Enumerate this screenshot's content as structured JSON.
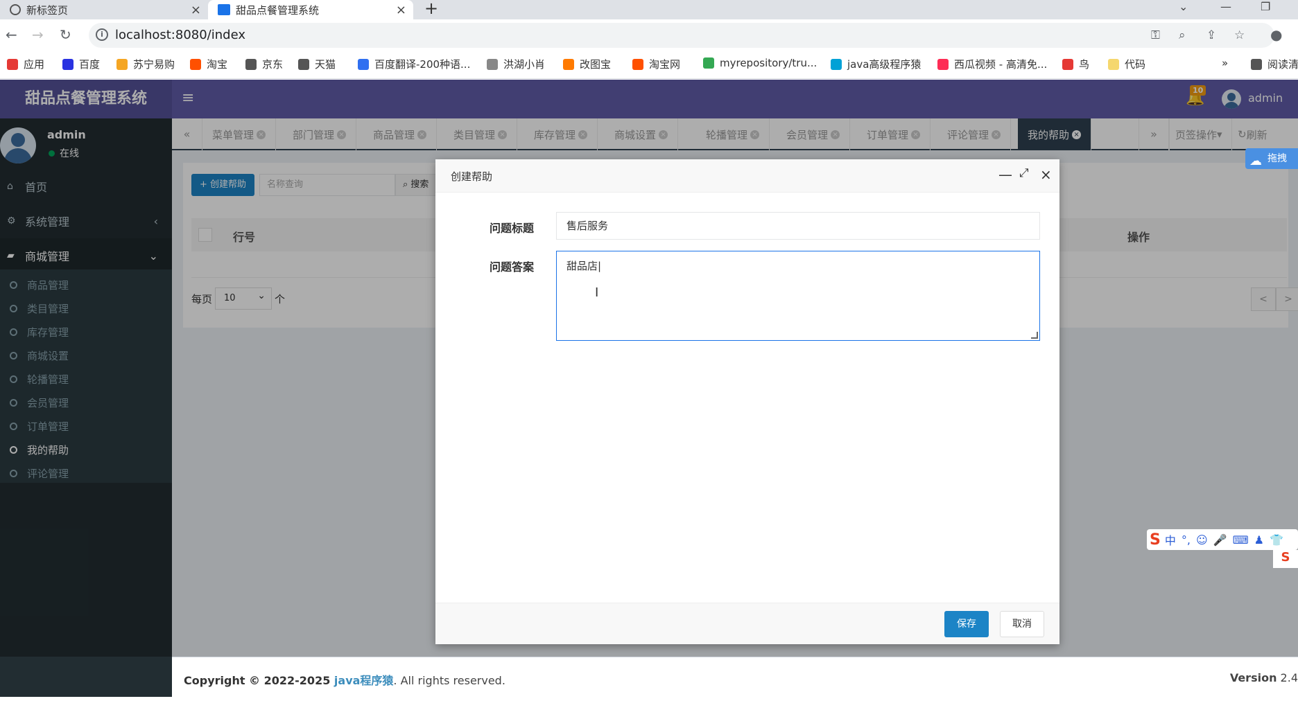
{
  "browser": {
    "tabs": [
      {
        "title": "新标签页"
      },
      {
        "title": "甜品点餐管理系统"
      }
    ],
    "new_tab": "+",
    "url": "localhost:8080/index",
    "bookmarks": [
      {
        "label": "应用",
        "color": "#e53935"
      },
      {
        "label": "百度",
        "color": "#2932e1"
      },
      {
        "label": "苏宁易购",
        "color": "#f5a623"
      },
      {
        "label": "淘宝",
        "color": "#ff5000"
      },
      {
        "label": "京东",
        "color": "#555555"
      },
      {
        "label": "天猫",
        "color": "#555555"
      },
      {
        "label": "百度翻译-200种语...",
        "color": "#2f6ff0"
      },
      {
        "label": "洪湖小肖",
        "color": "#888888"
      },
      {
        "label": "改图宝",
        "color": "#ff7a00"
      },
      {
        "label": "淘宝网",
        "color": "#ff5000"
      },
      {
        "label": "myrepository/tru...",
        "color": "#34a853"
      },
      {
        "label": "java高级程序猿",
        "color": "#00a1d6"
      },
      {
        "label": "西瓜视频 - 高清免...",
        "color": "#fe2c55"
      },
      {
        "label": "鸟",
        "color": "#e53935"
      },
      {
        "label": "代码",
        "color": "#f5d76e"
      },
      {
        "label": "阅读清",
        "color": "#555555"
      }
    ]
  },
  "app": {
    "logo": "甜品点餐管理系统",
    "hamburger_icon": "≡",
    "notification_count": "10",
    "username": "admin",
    "sidebar": {
      "user": "admin",
      "status": "在线",
      "menu": [
        {
          "label": "首页",
          "icon": "home-icon"
        },
        {
          "label": "系统管理",
          "icon": "gears-icon",
          "arrow": "‹"
        },
        {
          "label": "商城管理",
          "icon": "shopping-bag-icon",
          "arrow": "⌄"
        }
      ],
      "submenu": [
        "商品管理",
        "类目管理",
        "库存管理",
        "商城设置",
        "轮播管理",
        "会员管理",
        "订单管理",
        "我的帮助",
        "评论管理"
      ],
      "current_submenu": "我的帮助"
    },
    "page_tabs": [
      "菜单管理",
      "部门管理",
      "商品管理",
      "类目管理",
      "库存管理",
      "商城设置",
      "轮播管理",
      "会员管理",
      "订单管理",
      "评论管理",
      "我的帮助"
    ],
    "active_page_tab": "我的帮助",
    "tab_tools": {
      "page_ops": "页签操作",
      "refresh": "刷新"
    },
    "toolbar": {
      "create": "创建帮助",
      "search_placeholder": "名称查询",
      "search": "搜索"
    },
    "table": {
      "col_row_no": "行号",
      "col_ops": "操作"
    },
    "pagination": {
      "per_page_prefix": "每页",
      "per_page_value": "10",
      "per_page_suffix": "个",
      "prev": "<",
      "next": ">"
    },
    "footer": {
      "copyright_prefix": "Copyright © 2022-2025 ",
      "copyright_link": "java程序猿",
      "copyright_suffix": ". All rights reserved.",
      "version_label": "Version",
      "version_value": "2.4"
    }
  },
  "modal": {
    "title": "创建帮助",
    "fields": {
      "question_title_label": "问题标题",
      "question_title_value": "售后服务",
      "answer_label": "问题答案",
      "answer_value": "甜品店"
    },
    "save": "保存",
    "cancel": "取消"
  },
  "widgets": {
    "baidu_label": "拖拽",
    "ime_lang": "中"
  }
}
